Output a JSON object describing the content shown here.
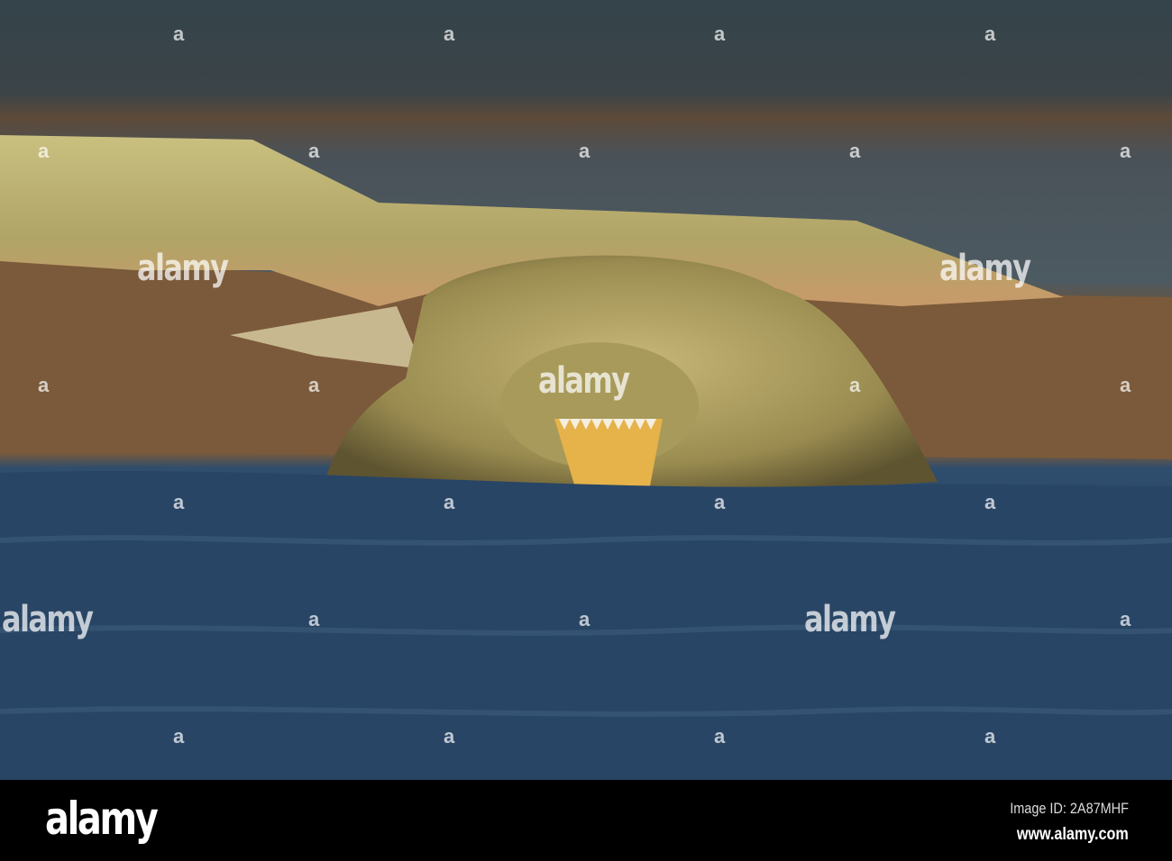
{
  "photo": {
    "watermark_text": "alamy",
    "watermark_mark": "a"
  },
  "footer": {
    "logo": "alamy",
    "image_id": "Image ID: 2A87MHF",
    "website": "www.alamy.com"
  },
  "colors": {
    "water": "#2a4866",
    "sand": "#7a5a3a",
    "croc": "#b0a466"
  }
}
